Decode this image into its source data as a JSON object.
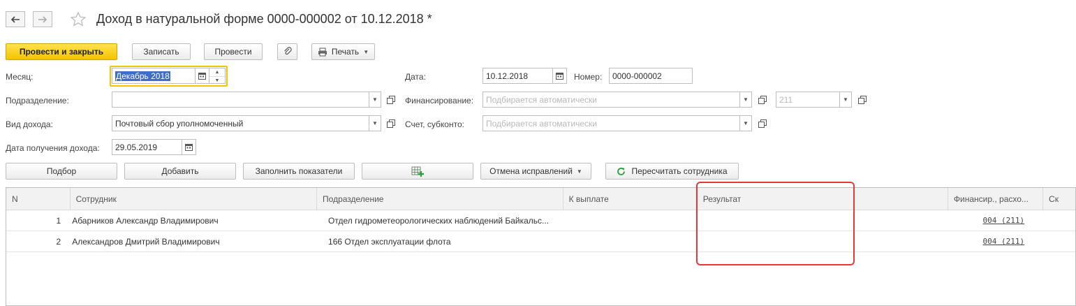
{
  "header": {
    "title": "Доход в натуральной форме 0000-000002 от 10.12.2018 *"
  },
  "toolbar": {
    "post_close": "Провести и закрыть",
    "save": "Записать",
    "post": "Провести",
    "print": "Печать"
  },
  "form": {
    "month_label": "Месяц:",
    "month_value": "Декабрь 2018",
    "date_label": "Дата:",
    "date_value": "10.12.2018",
    "number_label": "Номер:",
    "number_value": "0000-000002",
    "dept_label": "Подразделение:",
    "dept_value": "",
    "financing_label": "Финансирование:",
    "financing_placeholder": "Подбирается автоматически",
    "kosgu_placeholder": "211",
    "income_type_label": "Вид дохода:",
    "income_type_value": "Почтовый сбор уполномоченный",
    "account_label": "Счет, субконто:",
    "account_placeholder": "Подбирается автоматически",
    "income_date_label": "Дата получения дохода:",
    "income_date_value": "29.05.2019"
  },
  "table_toolbar": {
    "pick": "Подбор",
    "add": "Добавить",
    "fill": "Заполнить показатели",
    "cancel_fixes": "Отмена исправлений",
    "recalc": "Пересчитать сотрудника"
  },
  "table": {
    "columns": [
      "N",
      "Сотрудник",
      "Подразделение",
      "К выплате",
      "Результат",
      "Финансир., расхо...",
      "Ск"
    ],
    "rows": [
      {
        "n": "1",
        "employee": "Абарников Александр Владимирович",
        "dept": "Отдел гидрометеорологических наблюдений Байкальс...",
        "payout": "",
        "result": "",
        "fin": "004 (211)"
      },
      {
        "n": "2",
        "employee": "Александров Дмитрий Владимирович",
        "dept": "166 Отдел эксплуатации флота",
        "payout": "",
        "result": "",
        "fin": "004 (211)"
      }
    ]
  },
  "colors": {
    "primary_button": "#f5c400",
    "highlight": "#e53935",
    "recalc_icon": "#2e9b3f"
  }
}
